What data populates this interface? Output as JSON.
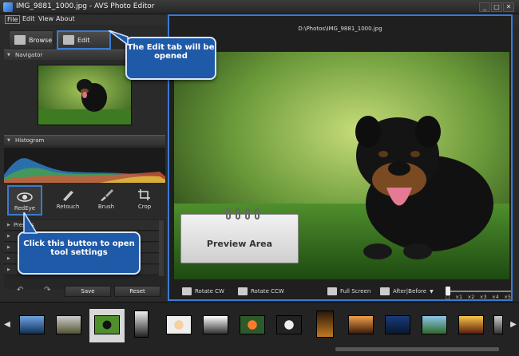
{
  "window": {
    "title": "IMG_9881_1000.jpg - AVS Photo Editor",
    "minimize": "_",
    "restore": "□",
    "close": "✕"
  },
  "menu": {
    "file": "File",
    "edit": "Edit",
    "view": "View",
    "about": "About"
  },
  "left": {
    "browse_label": "Browse",
    "edit_label": "Edit",
    "navigator_label": "Navigator",
    "histogram_label": "Histogram",
    "tools": [
      {
        "label": "RedEye"
      },
      {
        "label": "Retouch"
      },
      {
        "label": "Brush"
      },
      {
        "label": "Crop"
      }
    ],
    "presets_header": "Presets",
    "save_label": "Save",
    "reset_label": "Reset"
  },
  "main": {
    "file_path": "D:\\Photos\\IMG_9881_1000.jpg",
    "rotate_cw": "Rotate CW",
    "rotate_ccw": "Rotate CCW",
    "full_screen": "Full Screen",
    "after_before": "After|Before",
    "zoom_levels": [
      "□",
      "×1",
      "×2",
      "×3",
      "×4",
      "×5"
    ]
  },
  "callouts": {
    "edit_tab": "The Edit tab will be opened",
    "tool_settings": "Click this button to open tool settings",
    "preview_area": "Preview Area"
  },
  "colors": {
    "accent": "#3b7ad0",
    "callout": "#1f5aa8"
  }
}
